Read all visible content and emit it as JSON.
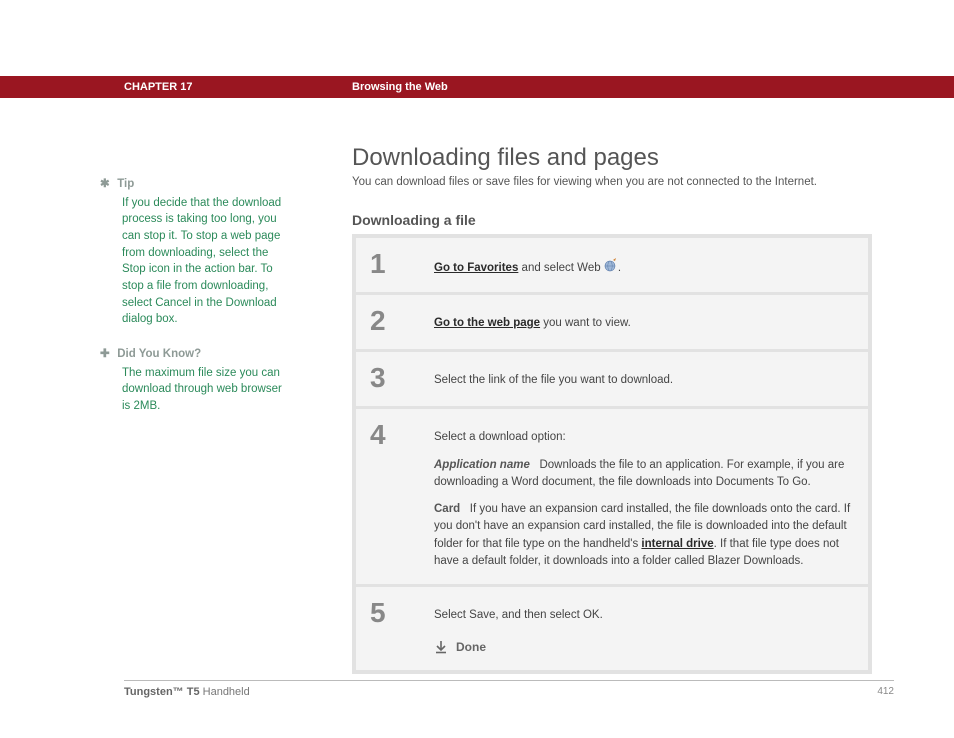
{
  "header": {
    "chapter": "CHAPTER 17",
    "title": "Browsing the Web"
  },
  "page": {
    "title": "Downloading files and pages",
    "intro": "You can download files or save files for viewing when you are not connected to the Internet.",
    "subtitle": "Downloading a file"
  },
  "sidebar": {
    "tip": {
      "label": "Tip",
      "body": "If you decide that the download process is taking too long, you can stop it. To stop a web page from downloading, select the Stop icon in the action bar. To stop a file from downloading, select Cancel in the Download dialog box."
    },
    "dyk": {
      "label": "Did You Know?",
      "body": "The maximum file size you can download through web browser is 2MB."
    }
  },
  "steps": {
    "s1": {
      "num": "1",
      "link": "Go to Favorites",
      "after": " and select Web ",
      "period": "."
    },
    "s2": {
      "num": "2",
      "link": "Go to the web page",
      "after": " you want to view."
    },
    "s3": {
      "num": "3",
      "text": "Select the link of the file you want to download."
    },
    "s4": {
      "num": "4",
      "lead": "Select a download option:",
      "opt1_label": "Application name",
      "opt1_text": "Downloads the file to an application. For example, if you are downloading a Word document, the file downloads into Documents To Go.",
      "opt2_label": "Card",
      "opt2_text_before": "If you have an expansion card installed, the file downloads onto the card. If you don't have an expansion card installed, the file is downloaded into the default folder for that file type on the handheld's ",
      "opt2_link": "internal drive",
      "opt2_text_after": ". If that file type does not have a default folder, it downloads into a folder called Blazer Downloads."
    },
    "s5": {
      "num": "5",
      "text": "Select Save, and then select OK.",
      "done": "Done"
    }
  },
  "footer": {
    "product_bold": "Tungsten™ T5",
    "product_rest": " Handheld",
    "page": "412"
  }
}
